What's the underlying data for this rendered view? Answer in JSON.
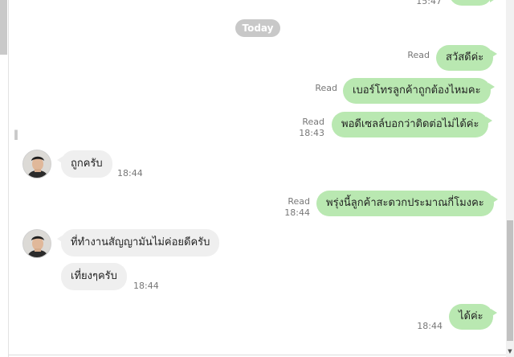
{
  "top_partial": {
    "time": "15:47"
  },
  "date_divider": "Today",
  "messages_out": [
    {
      "text": "สวัสดีค่ะ",
      "status": "Read",
      "time": ""
    },
    {
      "text": "เบอร์โทรลูกค้าถูกต้องไหมคะ",
      "status": "Read",
      "time": ""
    },
    {
      "text": "พอดีเซลล์บอกว่าติดต่อไม่ได้ค่ะ",
      "status": "Read",
      "time": "18:43"
    },
    {
      "text": "พรุ่งนี้ลูกค้าสะดวกประมาณกี่โมงคะ",
      "status": "Read",
      "time": "18:44"
    },
    {
      "text": "ได้ค่ะ",
      "status": "",
      "time": "18:44"
    }
  ],
  "messages_in": [
    {
      "text": "ถูกครับ",
      "time": "18:44"
    },
    {
      "text": "ที่ทำงานสัญญามันไม่ค่อยดีครับ",
      "time": ""
    },
    {
      "text": "เที่ยงๆครับ",
      "time": "18:44"
    }
  ],
  "colors": {
    "outgoing_bubble": "#b9e8b1",
    "incoming_bubble": "#efefef",
    "date_pill": "#c8c8c8"
  },
  "icons": {
    "resize_handle": "grip-icon",
    "scroll_down": "scroll-down-arrow-icon"
  }
}
